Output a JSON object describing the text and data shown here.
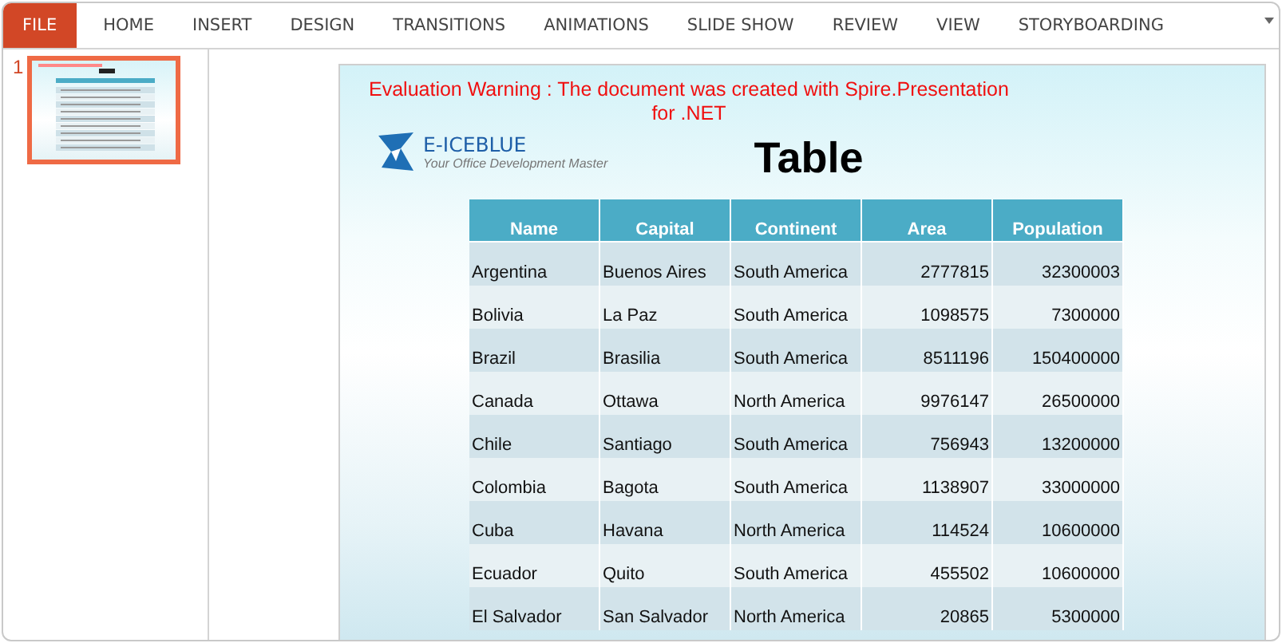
{
  "ribbon": {
    "tabs": [
      {
        "label": "FILE",
        "kind": "file"
      },
      {
        "label": "HOME",
        "kind": "tab"
      },
      {
        "label": "INSERT",
        "kind": "tab"
      },
      {
        "label": "DESIGN",
        "kind": "tab"
      },
      {
        "label": "TRANSITIONS",
        "kind": "tab"
      },
      {
        "label": "ANIMATIONS",
        "kind": "tab"
      },
      {
        "label": "SLIDE SHOW",
        "kind": "tab"
      },
      {
        "label": "REVIEW",
        "kind": "tab"
      },
      {
        "label": "VIEW",
        "kind": "tab"
      },
      {
        "label": "STORYBOARDING",
        "kind": "tab"
      }
    ]
  },
  "thumbnails": [
    {
      "number": "1",
      "selected": true
    }
  ],
  "slide": {
    "warning": [
      "Evaluation Warning : The document was created with  Spire.Presentation",
      "for .NET"
    ],
    "logo": {
      "name": "E-ICEBLUE",
      "tagline": "Your Office Development Master"
    },
    "title": "Table",
    "table": {
      "columns": [
        "Name",
        "Capital",
        "Continent",
        "Area",
        "Population"
      ],
      "rows": [
        [
          "Argentina",
          "Buenos Aires",
          "South America",
          "2777815",
          "32300003"
        ],
        [
          "Bolivia",
          "La Paz",
          "South America",
          "1098575",
          "7300000"
        ],
        [
          "Brazil",
          "Brasilia",
          "South America",
          "8511196",
          "150400000"
        ],
        [
          "Canada",
          "Ottawa",
          "North America",
          "9976147",
          "26500000"
        ],
        [
          "Chile",
          "Santiago",
          "South America",
          "756943",
          "13200000"
        ],
        [
          "Colombia",
          "Bagota",
          "South America",
          "1138907",
          "33000000"
        ],
        [
          "Cuba",
          "Havana",
          "North America",
          "114524",
          "10600000"
        ],
        [
          "Ecuador",
          "Quito",
          "South America",
          "455502",
          "10600000"
        ],
        [
          "El Salvador",
          "San Salvador",
          "North America",
          "20865",
          "5300000"
        ]
      ]
    }
  }
}
